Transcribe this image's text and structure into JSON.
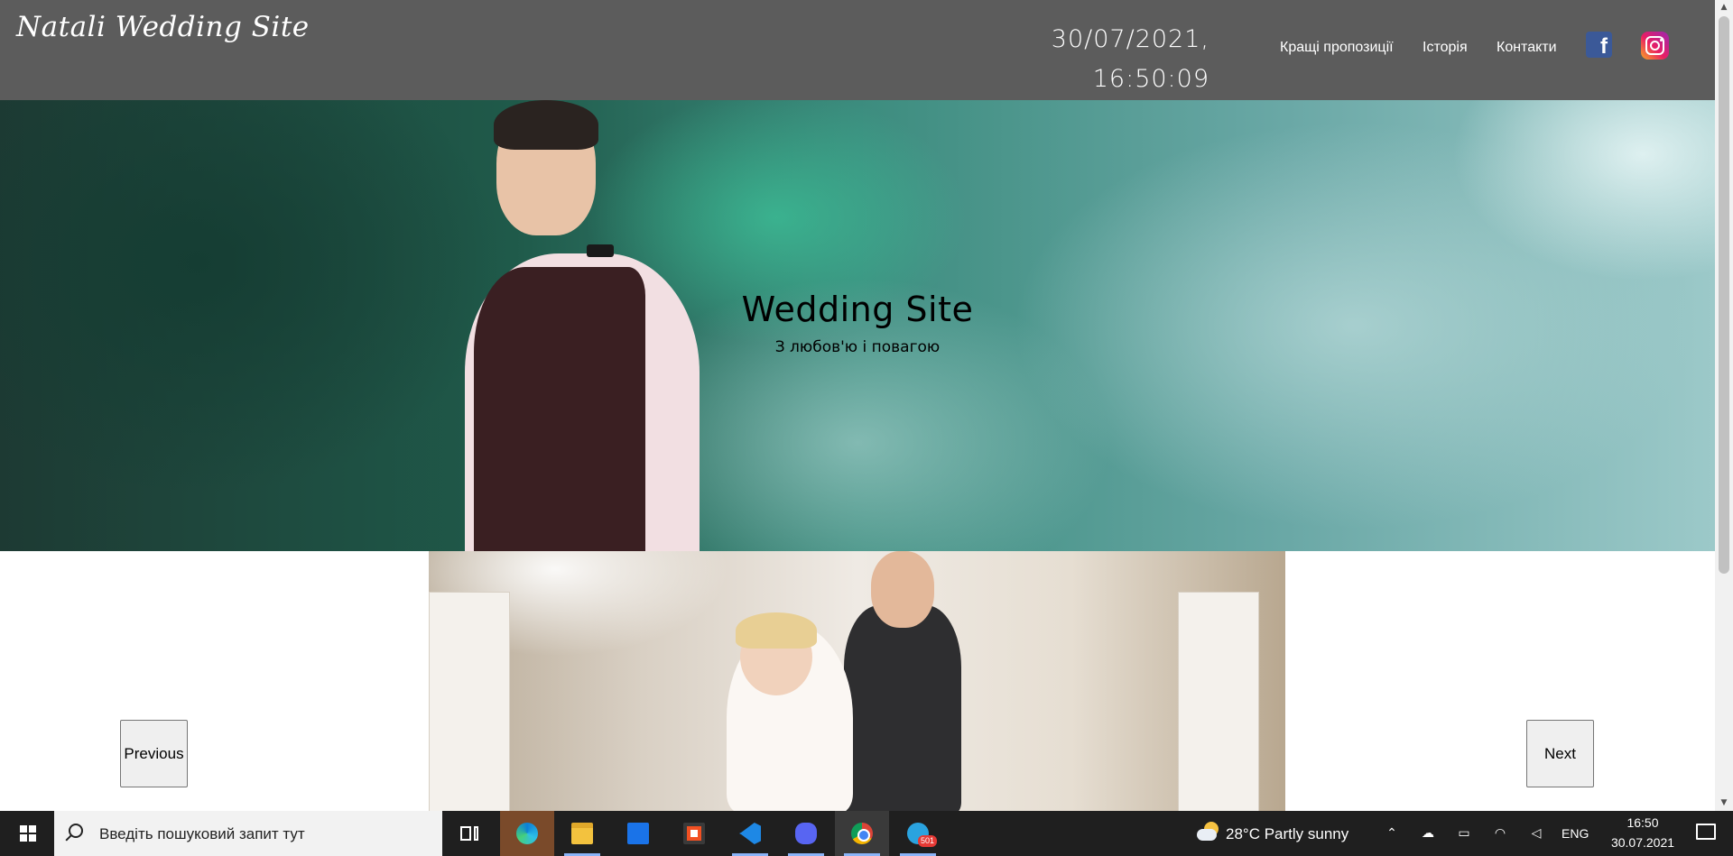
{
  "header": {
    "logo": "Natali Wedding Site",
    "date": "30/07/2021,",
    "time": "16:50:09",
    "nav": [
      "Кращі пропозиції",
      "Історія",
      "Контакти"
    ],
    "social": [
      "facebook-icon",
      "instagram-icon"
    ]
  },
  "hero": {
    "title": "Wedding Site",
    "subtitle": "З любов'ю і повагою"
  },
  "carousel": {
    "prev_label": "Previous",
    "next_label": "Next"
  },
  "taskbar": {
    "search_placeholder": "Введіть пошуковий запит тут",
    "apps": [
      "task-view",
      "edge",
      "file-explorer",
      "mail",
      "store",
      "vscode",
      "discord",
      "chrome",
      "telegram"
    ],
    "telegram_badge": "501",
    "weather": "28°C  Partly sunny",
    "language": "ENG",
    "clock_time": "16:50",
    "clock_date": "30.07.2021"
  },
  "colors": {
    "header_bg": "#5c5c5c",
    "taskbar_bg": "#1f1f1f",
    "facebook": "#3b5998"
  }
}
